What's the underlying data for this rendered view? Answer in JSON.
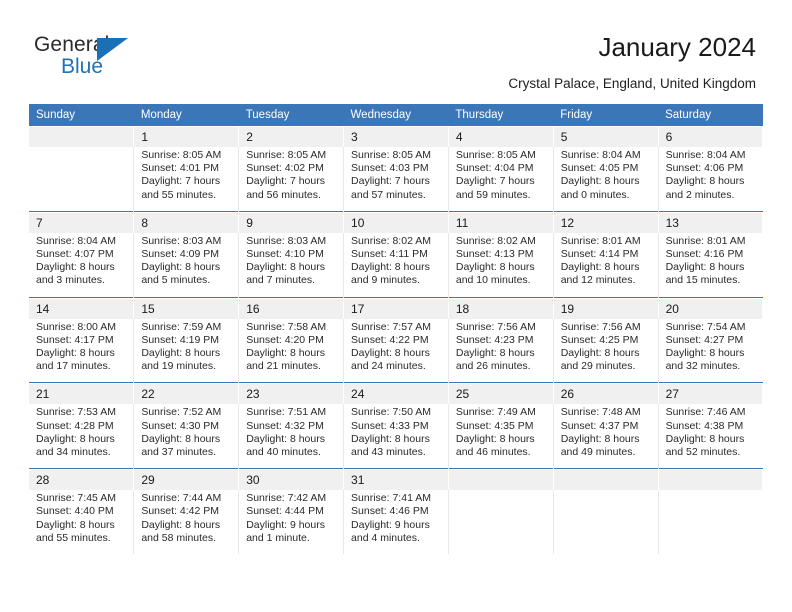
{
  "brand": {
    "name_part1": "General",
    "name_part2": "Blue",
    "triangle_icon": "triangle-icon",
    "accent_color": "#1a6fb5"
  },
  "header": {
    "title": "January 2024",
    "subtitle": "Crystal Palace, England, United Kingdom"
  },
  "calendar": {
    "header_bg": "#3b77b8",
    "daynum_bg": "#f0f0f0",
    "weekday_labels": [
      "Sunday",
      "Monday",
      "Tuesday",
      "Wednesday",
      "Thursday",
      "Friday",
      "Saturday"
    ],
    "weeks": [
      [
        {
          "day": "",
          "lines": []
        },
        {
          "day": "1",
          "lines": [
            "Sunrise: 8:05 AM",
            "Sunset: 4:01 PM",
            "Daylight: 7 hours",
            "and 55 minutes."
          ]
        },
        {
          "day": "2",
          "lines": [
            "Sunrise: 8:05 AM",
            "Sunset: 4:02 PM",
            "Daylight: 7 hours",
            "and 56 minutes."
          ]
        },
        {
          "day": "3",
          "lines": [
            "Sunrise: 8:05 AM",
            "Sunset: 4:03 PM",
            "Daylight: 7 hours",
            "and 57 minutes."
          ]
        },
        {
          "day": "4",
          "lines": [
            "Sunrise: 8:05 AM",
            "Sunset: 4:04 PM",
            "Daylight: 7 hours",
            "and 59 minutes."
          ]
        },
        {
          "day": "5",
          "lines": [
            "Sunrise: 8:04 AM",
            "Sunset: 4:05 PM",
            "Daylight: 8 hours",
            "and 0 minutes."
          ]
        },
        {
          "day": "6",
          "lines": [
            "Sunrise: 8:04 AM",
            "Sunset: 4:06 PM",
            "Daylight: 8 hours",
            "and 2 minutes."
          ]
        }
      ],
      [
        {
          "day": "7",
          "lines": [
            "Sunrise: 8:04 AM",
            "Sunset: 4:07 PM",
            "Daylight: 8 hours",
            "and 3 minutes."
          ]
        },
        {
          "day": "8",
          "lines": [
            "Sunrise: 8:03 AM",
            "Sunset: 4:09 PM",
            "Daylight: 8 hours",
            "and 5 minutes."
          ]
        },
        {
          "day": "9",
          "lines": [
            "Sunrise: 8:03 AM",
            "Sunset: 4:10 PM",
            "Daylight: 8 hours",
            "and 7 minutes."
          ]
        },
        {
          "day": "10",
          "lines": [
            "Sunrise: 8:02 AM",
            "Sunset: 4:11 PM",
            "Daylight: 8 hours",
            "and 9 minutes."
          ]
        },
        {
          "day": "11",
          "lines": [
            "Sunrise: 8:02 AM",
            "Sunset: 4:13 PM",
            "Daylight: 8 hours",
            "and 10 minutes."
          ]
        },
        {
          "day": "12",
          "lines": [
            "Sunrise: 8:01 AM",
            "Sunset: 4:14 PM",
            "Daylight: 8 hours",
            "and 12 minutes."
          ]
        },
        {
          "day": "13",
          "lines": [
            "Sunrise: 8:01 AM",
            "Sunset: 4:16 PM",
            "Daylight: 8 hours",
            "and 15 minutes."
          ]
        }
      ],
      [
        {
          "day": "14",
          "lines": [
            "Sunrise: 8:00 AM",
            "Sunset: 4:17 PM",
            "Daylight: 8 hours",
            "and 17 minutes."
          ]
        },
        {
          "day": "15",
          "lines": [
            "Sunrise: 7:59 AM",
            "Sunset: 4:19 PM",
            "Daylight: 8 hours",
            "and 19 minutes."
          ]
        },
        {
          "day": "16",
          "lines": [
            "Sunrise: 7:58 AM",
            "Sunset: 4:20 PM",
            "Daylight: 8 hours",
            "and 21 minutes."
          ]
        },
        {
          "day": "17",
          "lines": [
            "Sunrise: 7:57 AM",
            "Sunset: 4:22 PM",
            "Daylight: 8 hours",
            "and 24 minutes."
          ]
        },
        {
          "day": "18",
          "lines": [
            "Sunrise: 7:56 AM",
            "Sunset: 4:23 PM",
            "Daylight: 8 hours",
            "and 26 minutes."
          ]
        },
        {
          "day": "19",
          "lines": [
            "Sunrise: 7:56 AM",
            "Sunset: 4:25 PM",
            "Daylight: 8 hours",
            "and 29 minutes."
          ]
        },
        {
          "day": "20",
          "lines": [
            "Sunrise: 7:54 AM",
            "Sunset: 4:27 PM",
            "Daylight: 8 hours",
            "and 32 minutes."
          ]
        }
      ],
      [
        {
          "day": "21",
          "lines": [
            "Sunrise: 7:53 AM",
            "Sunset: 4:28 PM",
            "Daylight: 8 hours",
            "and 34 minutes."
          ]
        },
        {
          "day": "22",
          "lines": [
            "Sunrise: 7:52 AM",
            "Sunset: 4:30 PM",
            "Daylight: 8 hours",
            "and 37 minutes."
          ]
        },
        {
          "day": "23",
          "lines": [
            "Sunrise: 7:51 AM",
            "Sunset: 4:32 PM",
            "Daylight: 8 hours",
            "and 40 minutes."
          ]
        },
        {
          "day": "24",
          "lines": [
            "Sunrise: 7:50 AM",
            "Sunset: 4:33 PM",
            "Daylight: 8 hours",
            "and 43 minutes."
          ]
        },
        {
          "day": "25",
          "lines": [
            "Sunrise: 7:49 AM",
            "Sunset: 4:35 PM",
            "Daylight: 8 hours",
            "and 46 minutes."
          ]
        },
        {
          "day": "26",
          "lines": [
            "Sunrise: 7:48 AM",
            "Sunset: 4:37 PM",
            "Daylight: 8 hours",
            "and 49 minutes."
          ]
        },
        {
          "day": "27",
          "lines": [
            "Sunrise: 7:46 AM",
            "Sunset: 4:38 PM",
            "Daylight: 8 hours",
            "and 52 minutes."
          ]
        }
      ],
      [
        {
          "day": "28",
          "lines": [
            "Sunrise: 7:45 AM",
            "Sunset: 4:40 PM",
            "Daylight: 8 hours",
            "and 55 minutes."
          ]
        },
        {
          "day": "29",
          "lines": [
            "Sunrise: 7:44 AM",
            "Sunset: 4:42 PM",
            "Daylight: 8 hours",
            "and 58 minutes."
          ]
        },
        {
          "day": "30",
          "lines": [
            "Sunrise: 7:42 AM",
            "Sunset: 4:44 PM",
            "Daylight: 9 hours",
            "and 1 minute."
          ]
        },
        {
          "day": "31",
          "lines": [
            "Sunrise: 7:41 AM",
            "Sunset: 4:46 PM",
            "Daylight: 9 hours",
            "and 4 minutes."
          ]
        },
        {
          "day": "",
          "lines": []
        },
        {
          "day": "",
          "lines": []
        },
        {
          "day": "",
          "lines": []
        }
      ]
    ]
  }
}
